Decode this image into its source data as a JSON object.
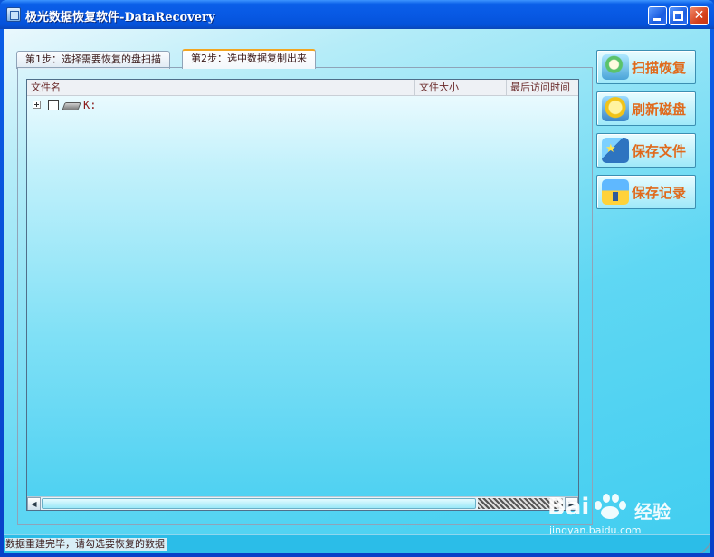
{
  "window": {
    "title": "极光数据恢复软件-DataRecovery"
  },
  "tabs": [
    {
      "label": "第1步：选择需要恢复的盘扫描",
      "active": false
    },
    {
      "label": "第2步：选中数据复制出来",
      "active": true
    }
  ],
  "list": {
    "columns": [
      "文件名",
      "文件大小",
      "最后访问时间"
    ],
    "rows": [
      {
        "label": "K:",
        "checked": false,
        "icon": "drive-icon",
        "expanded": false
      }
    ]
  },
  "actions": {
    "scan": {
      "label": "扫描恢复",
      "icon": "magnifier-icon"
    },
    "refresh": {
      "label": "刷新磁盘",
      "icon": "refresh-disk-icon"
    },
    "save_file": {
      "label": "保存文件",
      "icon": "folder-star-icon"
    },
    "save_record": {
      "label": "保存记录",
      "icon": "house-icon"
    }
  },
  "status": {
    "message": "数据重建完毕，请勾选要恢复的数据"
  },
  "watermark": {
    "brand_left": "Bai",
    "brand_right": "经验",
    "url": "jingyan.baidu.com"
  },
  "colors": {
    "titlebar": "#0a5fe8",
    "button_text": "#e06a1c",
    "active_tab_accent": "#f2a521"
  }
}
